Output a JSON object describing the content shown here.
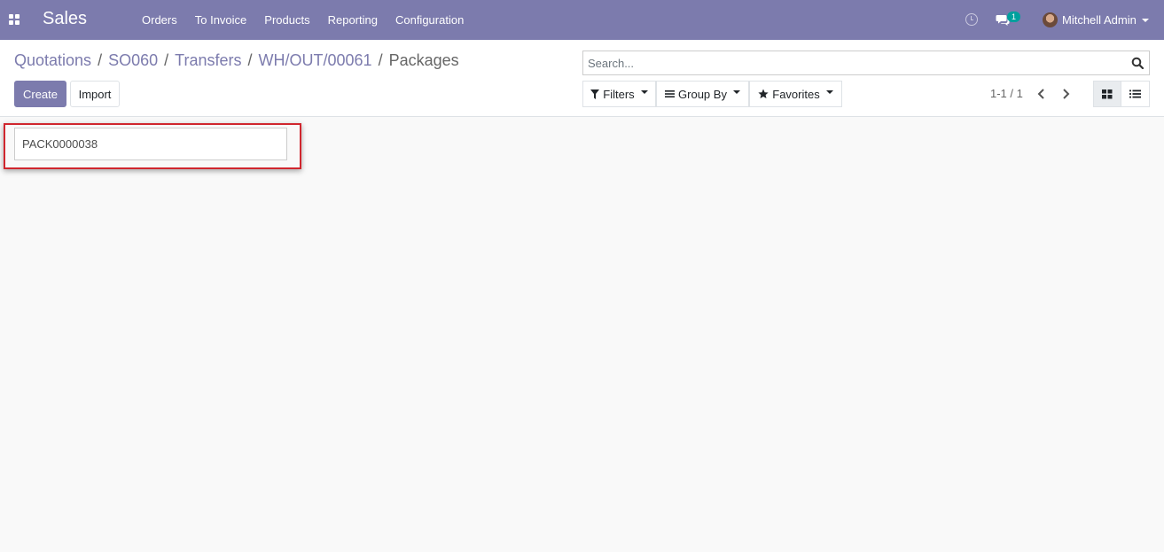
{
  "navbar": {
    "app_name": "Sales",
    "menu": [
      "Orders",
      "To Invoice",
      "Products",
      "Reporting",
      "Configuration"
    ],
    "chat_badge": "1",
    "user_name": "Mitchell Admin",
    "bg_color": "#7c7bad"
  },
  "breadcrumb": {
    "items": [
      "Quotations",
      "SO060",
      "Transfers",
      "WH/OUT/00061"
    ],
    "current": "Packages"
  },
  "buttons": {
    "create": "Create",
    "import": "Import"
  },
  "search": {
    "placeholder": "Search..."
  },
  "filters": {
    "filters": "Filters",
    "group_by": "Group By",
    "favorites": "Favorites"
  },
  "pager": {
    "value": "1-1 / 1"
  },
  "views": {
    "active": "kanban",
    "available": [
      "kanban",
      "list"
    ]
  },
  "records": [
    {
      "name": "PACK0000038"
    }
  ],
  "highlight_color": "#d0262e"
}
